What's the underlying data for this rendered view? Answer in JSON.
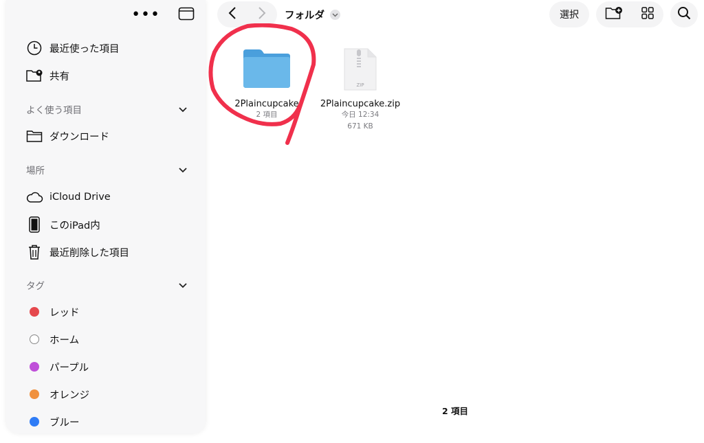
{
  "sidebar": {
    "recents_label": "最近使った項目",
    "shared_label": "共有",
    "favorites": {
      "header": "よく使う項目",
      "items": [
        {
          "label": "ダウンロード"
        }
      ]
    },
    "locations": {
      "header": "場所",
      "items": [
        {
          "label": "iCloud Drive"
        },
        {
          "label": "このiPad内"
        },
        {
          "label": "最近削除した項目"
        }
      ]
    },
    "tags": {
      "header": "タグ",
      "items": [
        {
          "label": "レッド",
          "color": "#e5484d"
        },
        {
          "label": "ホーム",
          "color": "#ffffff"
        },
        {
          "label": "パープル",
          "color": "#bf4fd9"
        },
        {
          "label": "オレンジ",
          "color": "#f0913f"
        },
        {
          "label": "ブルー",
          "color": "#2f7cf6"
        }
      ]
    }
  },
  "toolbar": {
    "folder_title": "フォルダ",
    "select_label": "選択"
  },
  "files": [
    {
      "name": "2Plaincupcake",
      "meta1": "2 項目",
      "type": "folder-icon"
    },
    {
      "name": "2Plaincupcake.zip",
      "meta1": "今日 12:34",
      "meta2": "671 KB",
      "type": "zip-file-icon",
      "badge": "ZIP"
    }
  ],
  "status_text": "2 項目",
  "colors": {
    "folder": "#5aaee6",
    "annotation": "#f0304c"
  }
}
